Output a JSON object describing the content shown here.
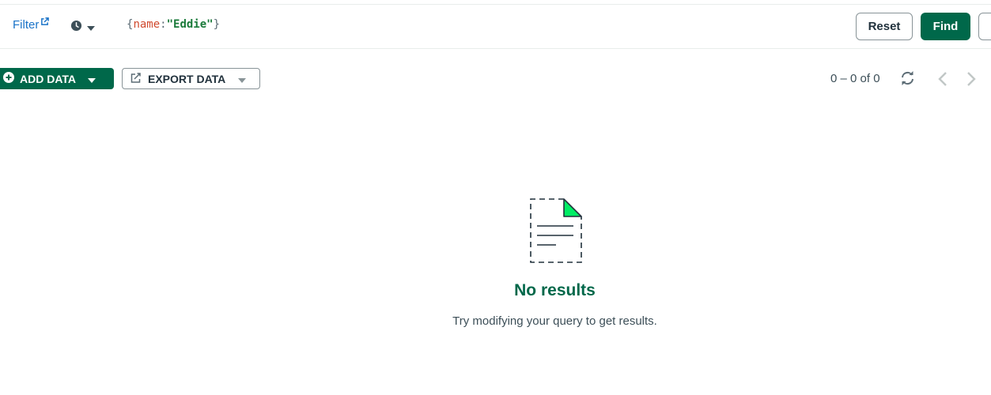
{
  "query_bar": {
    "filter_label": "Filter",
    "query": {
      "open": "{",
      "key": "name",
      "sep": ":",
      "value": "\"Eddie\"",
      "close": "}"
    },
    "reset_label": "Reset",
    "find_label": "Find"
  },
  "toolbar": {
    "add_data_label": "ADD DATA",
    "export_data_label": "EXPORT DATA",
    "pagination": "0 – 0 of 0"
  },
  "empty_state": {
    "title": "No results",
    "description": "Try modifying your query to get results."
  },
  "colors": {
    "primary": "#00684a",
    "link": "#1a73c8",
    "query_key": "#d04a2e",
    "query_string": "#1a7a3a",
    "doc_corner": "#00ed64"
  },
  "icons": [
    "external-link-icon",
    "history-clock-icon",
    "caret-down-icon",
    "plus-circle-icon",
    "export-icon",
    "refresh-icon",
    "chevron-left-icon",
    "chevron-right-icon",
    "empty-document-icon"
  ]
}
